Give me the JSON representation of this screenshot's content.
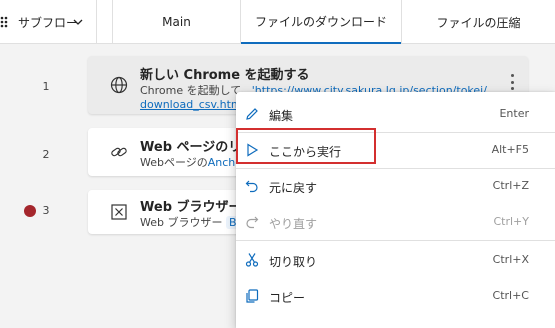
{
  "header": {
    "subflow_label": "サブフロー",
    "tabs": [
      "Main",
      "ファイルのダウンロード",
      "ファイルの圧縮"
    ],
    "active_tab": "ファイルのダウンロード"
  },
  "steps": [
    {
      "line": "1",
      "title": "新しい Chrome を起動する",
      "desc_prefix": "Chrome を起動して、",
      "desc_link": "'https://www.city.sakura.lg.jp/section/tokei/",
      "desc_link2": "download_csv.html'",
      "icon": "globe-icon",
      "breakpoint": false
    },
    {
      "line": "2",
      "title": "Web ページのリンク",
      "desc_prefix": "Webページの",
      "desc_link": "Ancho",
      "icon": "link-icon",
      "breakpoint": false
    },
    {
      "line": "3",
      "title": "Web ブラウザーを閉",
      "desc_prefix": "Web ブラウザー",
      "desc_pill": "Bro",
      "icon": "close-box-icon",
      "breakpoint": true
    }
  ],
  "context_menu": {
    "items": [
      {
        "label": "編集",
        "shortcut": "Enter",
        "icon": "pencil-icon",
        "disabled": false
      },
      {
        "label": "ここから実行",
        "shortcut": "Alt+F5",
        "icon": "play-icon",
        "disabled": false
      },
      {
        "label": "元に戻す",
        "shortcut": "Ctrl+Z",
        "icon": "undo-icon",
        "disabled": false
      },
      {
        "label": "やり直す",
        "shortcut": "Ctrl+Y",
        "icon": "redo-icon",
        "disabled": true
      },
      {
        "label": "切り取り",
        "shortcut": "Ctrl+X",
        "icon": "scissors-icon",
        "disabled": false
      },
      {
        "label": "コピー",
        "shortcut": "Ctrl+C",
        "icon": "copy-icon",
        "disabled": false
      }
    ],
    "highlighted_item": "ここから実行"
  },
  "colors": {
    "accent": "#0f6cbd",
    "breakpoint": "#a4262c",
    "highlight_border": "#d32f2f"
  }
}
